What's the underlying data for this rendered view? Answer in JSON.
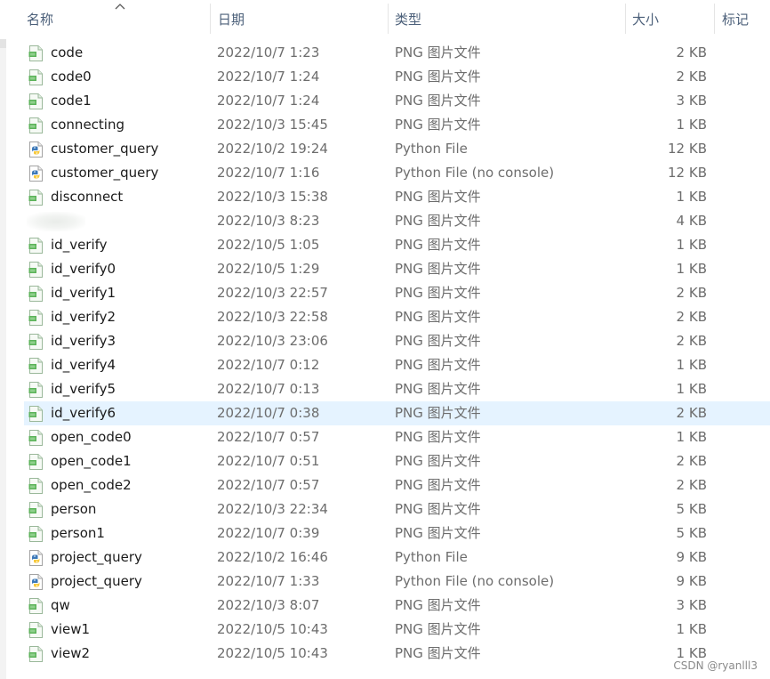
{
  "columns": {
    "name": "名称",
    "date": "日期",
    "type": "类型",
    "size": "大小",
    "tags": "标记"
  },
  "sort_indicator": "ascending-chevron-icon",
  "selected_row_index": 15,
  "files": [
    {
      "name": "code",
      "date": "2022/10/7 1:23",
      "type": "PNG 图片文件",
      "size": "2 KB",
      "icon": "png-image-icon"
    },
    {
      "name": "code0",
      "date": "2022/10/7 1:24",
      "type": "PNG 图片文件",
      "size": "2 KB",
      "icon": "png-image-icon"
    },
    {
      "name": "code1",
      "date": "2022/10/7 1:24",
      "type": "PNG 图片文件",
      "size": "3 KB",
      "icon": "png-image-icon"
    },
    {
      "name": "connecting",
      "date": "2022/10/3 15:45",
      "type": "PNG 图片文件",
      "size": "1 KB",
      "icon": "png-image-icon"
    },
    {
      "name": "customer_query",
      "date": "2022/10/2 19:24",
      "type": "Python File",
      "size": "12 KB",
      "icon": "python-file-icon"
    },
    {
      "name": "customer_query",
      "date": "2022/10/7 1:16",
      "type": "Python File (no console)",
      "size": "12 KB",
      "icon": "python-file-icon"
    },
    {
      "name": "disconnect",
      "date": "2022/10/3 15:38",
      "type": "PNG 图片文件",
      "size": "1 KB",
      "icon": "png-image-icon"
    },
    {
      "name": "",
      "date": "2022/10/3 8:23",
      "type": "PNG 图片文件",
      "size": "4 KB",
      "icon": "blurred-icon"
    },
    {
      "name": "id_verify",
      "date": "2022/10/5 1:05",
      "type": "PNG 图片文件",
      "size": "1 KB",
      "icon": "png-image-icon"
    },
    {
      "name": "id_verify0",
      "date": "2022/10/5 1:29",
      "type": "PNG 图片文件",
      "size": "1 KB",
      "icon": "png-image-icon"
    },
    {
      "name": "id_verify1",
      "date": "2022/10/3 22:57",
      "type": "PNG 图片文件",
      "size": "2 KB",
      "icon": "png-image-icon"
    },
    {
      "name": "id_verify2",
      "date": "2022/10/3 22:58",
      "type": "PNG 图片文件",
      "size": "2 KB",
      "icon": "png-image-icon"
    },
    {
      "name": "id_verify3",
      "date": "2022/10/3 23:06",
      "type": "PNG 图片文件",
      "size": "2 KB",
      "icon": "png-image-icon"
    },
    {
      "name": "id_verify4",
      "date": "2022/10/7 0:12",
      "type": "PNG 图片文件",
      "size": "1 KB",
      "icon": "png-image-icon"
    },
    {
      "name": "id_verify5",
      "date": "2022/10/7 0:13",
      "type": "PNG 图片文件",
      "size": "1 KB",
      "icon": "png-image-icon"
    },
    {
      "name": "id_verify6",
      "date": "2022/10/7 0:38",
      "type": "PNG 图片文件",
      "size": "2 KB",
      "icon": "png-image-icon"
    },
    {
      "name": "open_code0",
      "date": "2022/10/7 0:57",
      "type": "PNG 图片文件",
      "size": "1 KB",
      "icon": "png-image-icon"
    },
    {
      "name": "open_code1",
      "date": "2022/10/7 0:51",
      "type": "PNG 图片文件",
      "size": "2 KB",
      "icon": "png-image-icon"
    },
    {
      "name": "open_code2",
      "date": "2022/10/7 0:57",
      "type": "PNG 图片文件",
      "size": "2 KB",
      "icon": "png-image-icon"
    },
    {
      "name": "person",
      "date": "2022/10/3 22:34",
      "type": "PNG 图片文件",
      "size": "5 KB",
      "icon": "png-image-icon"
    },
    {
      "name": "person1",
      "date": "2022/10/7 0:39",
      "type": "PNG 图片文件",
      "size": "5 KB",
      "icon": "png-image-icon"
    },
    {
      "name": "project_query",
      "date": "2022/10/2 16:46",
      "type": "Python File",
      "size": "9 KB",
      "icon": "python-file-icon"
    },
    {
      "name": "project_query",
      "date": "2022/10/7 1:33",
      "type": "Python File (no console)",
      "size": "9 KB",
      "icon": "python-file-icon"
    },
    {
      "name": "qw",
      "date": "2022/10/3 8:07",
      "type": "PNG 图片文件",
      "size": "3 KB",
      "icon": "png-image-icon"
    },
    {
      "name": "view1",
      "date": "2022/10/5 10:43",
      "type": "PNG 图片文件",
      "size": "1 KB",
      "icon": "png-image-icon"
    },
    {
      "name": "view2",
      "date": "2022/10/5 10:43",
      "type": "PNG 图片文件",
      "size": "1 KB",
      "icon": "png-image-icon"
    }
  ],
  "watermark": "CSDN @ryanlll3",
  "colors": {
    "selected_row": "#e5f3ff",
    "header_text": "#4c607a",
    "png_icon_green": "#4caf50",
    "python_blue": "#3776ab",
    "python_yellow": "#ffd43b"
  }
}
